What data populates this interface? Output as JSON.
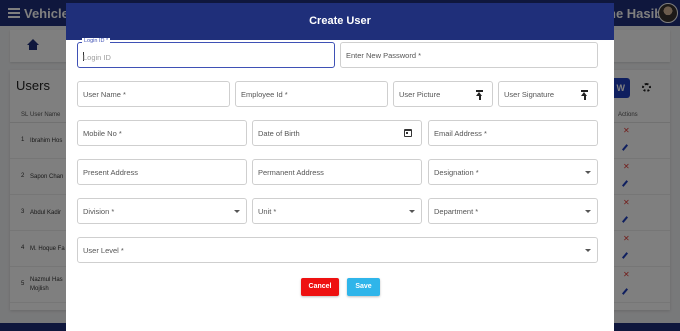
{
  "app": {
    "title": "Vehicle M",
    "user_name": "ne Hasib"
  },
  "users_page": {
    "title": "Users",
    "new_button": "W",
    "columns": {
      "sl": "SL",
      "user_name": "User Name",
      "actions": "Actions"
    },
    "rows": [
      {
        "sl": "1",
        "name": "Ibrahim Hos"
      },
      {
        "sl": "2",
        "name": "Sapon Chan"
      },
      {
        "sl": "3",
        "name": "Abdul Kadir"
      },
      {
        "sl": "4",
        "name": "M. Hoque Fa"
      },
      {
        "sl": "5",
        "name": "Nazmul Has",
        "name2": "Mojlish"
      }
    ],
    "delete_glyph": "✕"
  },
  "modal": {
    "title": "Create User",
    "fields": {
      "login_id": {
        "label": "Login ID *",
        "placeholder": "Login ID"
      },
      "password": {
        "placeholder": "Enter New Password *"
      },
      "user_name": {
        "placeholder": "User Name *"
      },
      "employee_id": {
        "placeholder": "Employee Id *"
      },
      "user_picture": {
        "placeholder": "User Picture"
      },
      "user_signature": {
        "placeholder": "User Signature"
      },
      "mobile": {
        "placeholder": "Mobile No *"
      },
      "dob": {
        "placeholder": "Date of Birth"
      },
      "email": {
        "placeholder": "Email Address *"
      },
      "present_address": {
        "placeholder": "Present Address"
      },
      "permanent_address": {
        "placeholder": "Permanent Address"
      },
      "designation": {
        "placeholder": "Designation *"
      },
      "division": {
        "placeholder": "Division *"
      },
      "unit": {
        "placeholder": "Unit *"
      },
      "department": {
        "placeholder": "Department *"
      },
      "user_level": {
        "placeholder": "User Level *"
      }
    },
    "buttons": {
      "cancel": "Cancel",
      "save": "Save"
    }
  },
  "colors": {
    "primary": "#1f2f7a",
    "focus": "#3f51b5",
    "cancel": "#ee1111",
    "save": "#2fb5ea",
    "delete": "#e53935"
  }
}
